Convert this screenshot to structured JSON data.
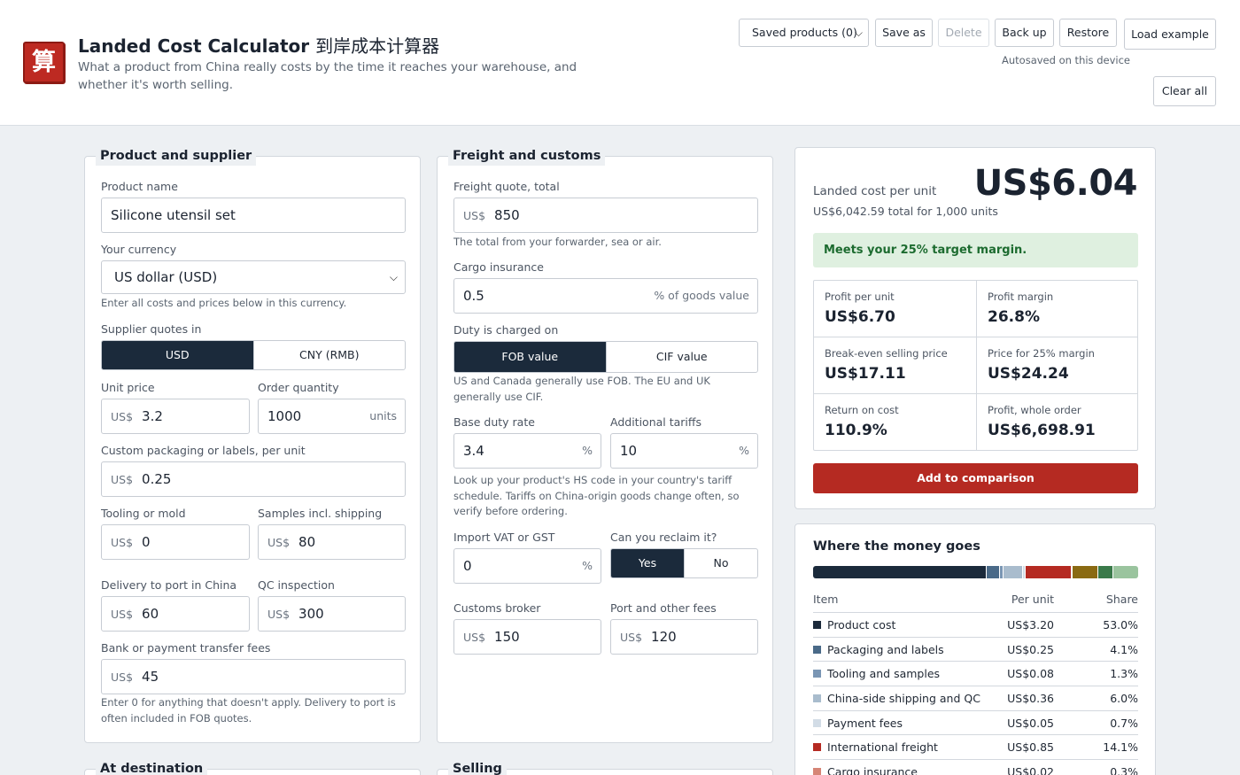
{
  "header": {
    "logo_char": "算",
    "title": "Landed Cost Calculator",
    "title_cn": "到岸成本计算器",
    "subtitle": "What a product from China really costs by the time it reaches your warehouse, and whether it's worth selling.",
    "saved_products": "Saved products (0)",
    "save_as": "Save as",
    "delete": "Delete",
    "back_up": "Back up",
    "restore": "Restore",
    "load_example": "Load example",
    "autosave_note": "Autosaved on this device",
    "clear_all": "Clear all"
  },
  "product": {
    "legend": "Product and supplier",
    "name_label": "Product name",
    "name_value": "Silicone utensil set",
    "currency_label": "Your currency",
    "currency_value": "US dollar (USD)",
    "currency_help": "Enter all costs and prices below in this currency.",
    "quotes_label": "Supplier quotes in",
    "quotes_opt1": "USD",
    "quotes_opt2": "CNY (RMB)",
    "unit_price_label": "Unit price",
    "unit_price": "3.2",
    "order_qty_label": "Order quantity",
    "order_qty": "1000",
    "units": "units",
    "packaging_label": "Custom packaging or labels, per unit",
    "packaging": "0.25",
    "tooling_label": "Tooling or mold",
    "tooling": "0",
    "samples_label": "Samples incl. shipping",
    "samples": "80",
    "delivery_label": "Delivery to port in China",
    "delivery": "60",
    "qc_label": "QC inspection",
    "qc": "300",
    "bank_label": "Bank or payment transfer fees",
    "bank": "45",
    "help": "Enter 0 for anything that doesn't apply. Delivery to port is often included in FOB quotes.",
    "prefix": "US$"
  },
  "freight": {
    "legend": "Freight and customs",
    "quote_label": "Freight quote, total",
    "quote": "850",
    "quote_help": "The total from your forwarder, sea or air.",
    "insurance_label": "Cargo insurance",
    "insurance": "0.5",
    "insurance_suffix": "% of goods value",
    "duty_on_label": "Duty is charged on",
    "duty_opt1": "FOB value",
    "duty_opt2": "CIF value",
    "duty_help": "US and Canada generally use FOB. The EU and UK generally use CIF.",
    "base_duty_label": "Base duty rate",
    "base_duty": "3.4",
    "tariffs_label": "Additional tariffs",
    "tariffs": "10",
    "tariff_help": "Look up your product's HS code in your country's tariff schedule. Tariffs on China-origin goods change often, so verify before ordering.",
    "vat_label": "Import VAT or GST",
    "vat": "0",
    "reclaim_label": "Can you reclaim it?",
    "reclaim_yes": "Yes",
    "reclaim_no": "No",
    "broker_label": "Customs broker",
    "broker": "150",
    "port_label": "Port and other fees",
    "port": "120",
    "pct": "%",
    "prefix": "US$"
  },
  "bottom": {
    "dest_legend": "At destination",
    "selling_legend": "Selling"
  },
  "summary": {
    "label": "Landed cost per unit",
    "total": "US$6,042.59 total for 1,000 units",
    "big": "US$6.04",
    "margin_msg": "Meets your 25% target margin.",
    "stats": [
      {
        "k": "Profit per unit",
        "v": "US$6.70"
      },
      {
        "k": "Profit margin",
        "v": "26.8%"
      },
      {
        "k": "Break-even selling price",
        "v": "US$17.11"
      },
      {
        "k": "Price for 25% margin",
        "v": "US$24.24"
      },
      {
        "k": "Return on cost",
        "v": "110.9%"
      },
      {
        "k": "Profit, whole order",
        "v": "US$6,698.91"
      }
    ],
    "add_btn": "Add to comparison"
  },
  "breakdown": {
    "title": "Where the money goes",
    "bar": [
      {
        "share": 53.0,
        "color": "#1b2a3b"
      },
      {
        "share": 4.1,
        "color": "#4a6a88"
      },
      {
        "share": 1.3,
        "color": "#7a96b4"
      },
      {
        "share": 6.0,
        "color": "#a9bccd"
      },
      {
        "share": 0.7,
        "color": "#d2dce6"
      },
      {
        "share": 14.1,
        "color": "#b52a22"
      },
      {
        "share": 0.3,
        "color": "#d68576"
      },
      {
        "share": 8.0,
        "color": "#8a6a12"
      },
      {
        "share": 4.5,
        "color": "#3a7a4a"
      },
      {
        "share": 8.0,
        "color": "#9ac49e"
      }
    ],
    "col_item": "Item",
    "col_per_unit": "Per unit",
    "col_share": "Share",
    "rows": [
      {
        "item": "Product cost",
        "per": "US$3.20",
        "share": "53.0%",
        "color": "#1b2a3b"
      },
      {
        "item": "Packaging and labels",
        "per": "US$0.25",
        "share": "4.1%",
        "color": "#4a6a88"
      },
      {
        "item": "Tooling and samples",
        "per": "US$0.08",
        "share": "1.3%",
        "color": "#7a96b4"
      },
      {
        "item": "China-side shipping and QC",
        "per": "US$0.36",
        "share": "6.0%",
        "color": "#a9bccd"
      },
      {
        "item": "Payment fees",
        "per": "US$0.05",
        "share": "0.7%",
        "color": "#d2dce6"
      },
      {
        "item": "International freight",
        "per": "US$0.85",
        "share": "14.1%",
        "color": "#b52a22"
      },
      {
        "item": "Cargo insurance",
        "per": "US$0.02",
        "share": "0.3%",
        "color": "#d68576"
      }
    ]
  }
}
